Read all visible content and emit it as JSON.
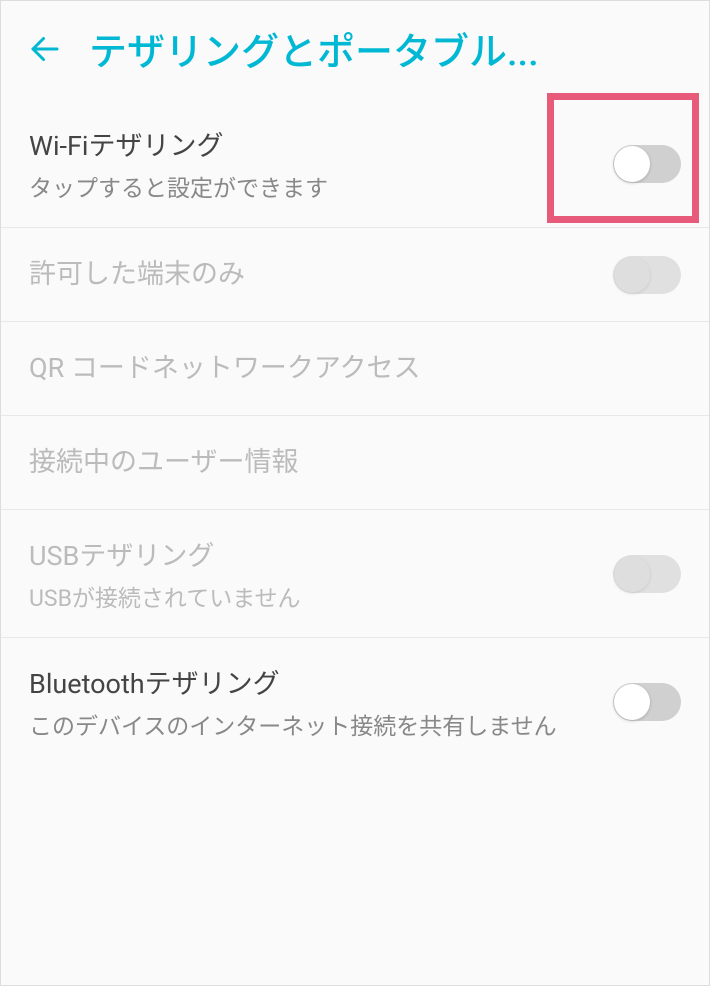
{
  "header": {
    "title": "テザリングとポータブル..."
  },
  "items": [
    {
      "title": "Wi-Fiテザリング",
      "subtitle": "タップすると設定ができます",
      "hasToggle": true,
      "disabled": false
    },
    {
      "title": "許可した端末のみ",
      "subtitle": "",
      "hasToggle": true,
      "disabled": true
    },
    {
      "title": "QR コードネットワークアクセス",
      "subtitle": "",
      "hasToggle": false,
      "disabled": true
    },
    {
      "title": "接続中のユーザー情報",
      "subtitle": "",
      "hasToggle": false,
      "disabled": true
    },
    {
      "title": "USBテザリング",
      "subtitle": "USBが接続されていません",
      "hasToggle": true,
      "disabled": true
    },
    {
      "title": "Bluetoothテザリング",
      "subtitle": "このデバイスのインターネット接続を共有しません",
      "hasToggle": true,
      "disabled": false
    }
  ]
}
